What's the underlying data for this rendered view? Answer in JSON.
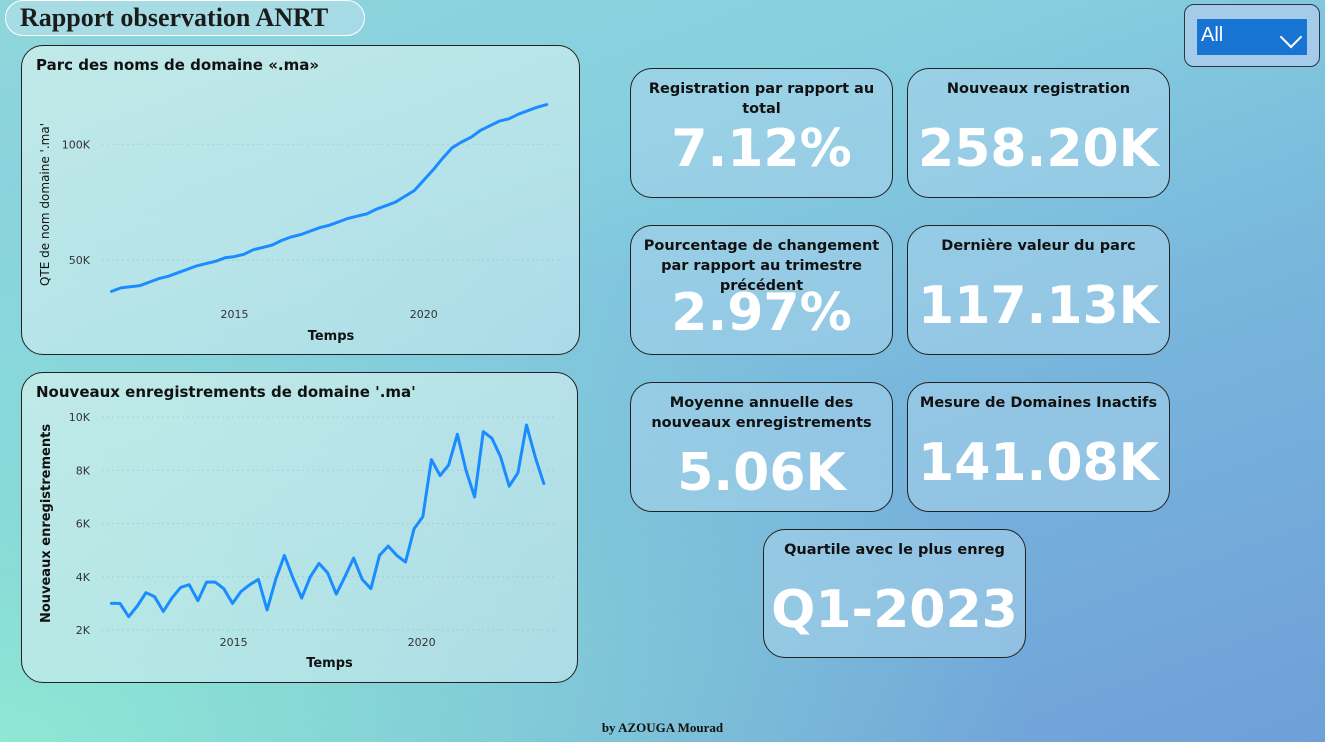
{
  "header": {
    "title": "Rapport observation ANRT"
  },
  "slicer": {
    "selected": "All"
  },
  "footer": {
    "credit": "by AZOUGA Mourad"
  },
  "kpis": {
    "registration_ratio": {
      "label": "Registration par rapport au total",
      "value": "7.12%"
    },
    "new_registrations": {
      "label": "Nouveaux registration",
      "value": "258.20K"
    },
    "pct_change": {
      "label": "Pourcentage de changement par rapport au trimestre précédent",
      "value": "2.97%"
    },
    "last_park_value": {
      "label": "Dernière valeur du parc",
      "value": "117.13K"
    },
    "annual_mean": {
      "label": "Moyenne annuelle des nouveaux enregistrements",
      "value": "5.06K"
    },
    "inactive_domains": {
      "label": "Mesure de Domaines Inactifs",
      "value": "141.08K"
    },
    "best_quarter": {
      "label": "Quartile avec le plus enreg",
      "value": "Q1-2023"
    }
  },
  "colors": {
    "line": "#1a8cff",
    "accent": "#1874d2"
  },
  "chart_data": [
    {
      "type": "line",
      "title": "Parc des noms de domaine «.ma»",
      "xlabel": "Temps",
      "ylabel": "QTE de nom domaine '.ma'",
      "xticks": [
        {
          "label": "2015",
          "x": 2015
        },
        {
          "label": "2020",
          "x": 2020
        }
      ],
      "yticks": [
        {
          "label": "50K",
          "y": 50000
        },
        {
          "label": "100K",
          "y": 100000
        }
      ],
      "xlim": [
        2011.5,
        2023.6
      ],
      "ylim": [
        25000,
        123000
      ],
      "x": [
        2011.75,
        2012,
        2012.25,
        2012.5,
        2012.75,
        2013,
        2013.25,
        2013.5,
        2013.75,
        2014,
        2014.25,
        2014.5,
        2014.75,
        2015,
        2015.25,
        2015.5,
        2015.75,
        2016,
        2016.25,
        2016.5,
        2016.75,
        2017,
        2017.25,
        2017.5,
        2017.75,
        2018,
        2018.25,
        2018.5,
        2018.75,
        2019,
        2019.25,
        2019.5,
        2019.75,
        2020,
        2020.25,
        2020.5,
        2020.75,
        2021,
        2021.25,
        2021.5,
        2021.75,
        2022,
        2022.25,
        2022.5,
        2022.75,
        2023,
        2023.25
      ],
      "series": [
        {
          "values": [
            36500,
            38000,
            38500,
            39000,
            40500,
            42000,
            43000,
            44500,
            46000,
            47500,
            48500,
            49500,
            51000,
            51500,
            52500,
            54500,
            55500,
            56500,
            58500,
            60000,
            61000,
            62500,
            64000,
            65000,
            66500,
            68000,
            69000,
            70000,
            72000,
            73500,
            75000,
            77500,
            80000,
            84500,
            89000,
            94000,
            98500,
            101000,
            103000,
            106000,
            108000,
            110000,
            111000,
            113000,
            114500,
            116000,
            117130
          ]
        }
      ]
    },
    {
      "type": "line",
      "title": "Nouveaux enregistrements de domaine '.ma'",
      "xlabel": "Temps",
      "ylabel": "Nouveaux enregistrements",
      "xticks": [
        {
          "label": "2015",
          "x": 2015
        },
        {
          "label": "2020",
          "x": 2020
        }
      ],
      "yticks": [
        {
          "label": "2K",
          "y": 2000
        },
        {
          "label": "4K",
          "y": 4000
        },
        {
          "label": "6K",
          "y": 6000
        },
        {
          "label": "8K",
          "y": 8000
        },
        {
          "label": "10K",
          "y": 10000
        }
      ],
      "xlim": [
        2011.5,
        2023.6
      ],
      "ylim": [
        2000,
        10000
      ],
      "x": [
        2011.75,
        2012,
        2012.25,
        2012.5,
        2012.75,
        2013,
        2013.25,
        2013.5,
        2013.75,
        2014,
        2014.25,
        2014.5,
        2014.75,
        2015,
        2015.25,
        2015.5,
        2015.75,
        2016,
        2016.25,
        2016.5,
        2016.75,
        2017,
        2017.25,
        2017.5,
        2017.75,
        2018,
        2018.25,
        2018.5,
        2018.75,
        2019,
        2019.25,
        2019.5,
        2019.75,
        2020,
        2020.25,
        2020.5,
        2020.75,
        2021,
        2021.25,
        2021.5,
        2021.75,
        2022,
        2022.25,
        2022.5,
        2022.75,
        2023,
        2023.25
      ],
      "series": [
        {
          "values": [
            3000,
            3000,
            2500,
            2900,
            3400,
            3250,
            2700,
            3200,
            3600,
            3700,
            3100,
            3800,
            3800,
            3550,
            3000,
            3450,
            3700,
            3900,
            2750,
            3900,
            4800,
            3950,
            3200,
            4000,
            4500,
            4150,
            3350,
            4000,
            4700,
            3900,
            3550,
            4800,
            5150,
            4800,
            4550,
            5800,
            6250,
            8400,
            7800,
            8200,
            9350,
            8000,
            7000,
            9450,
            9200,
            8500,
            7400,
            7900,
            9700,
            8500,
            7500
          ]
        }
      ]
    }
  ]
}
